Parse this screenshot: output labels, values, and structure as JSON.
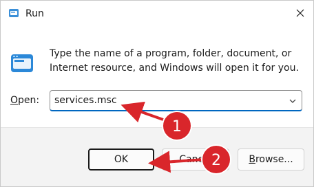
{
  "window": {
    "title": "Run",
    "close_icon": "close-icon",
    "app_icon": "run-icon"
  },
  "dialog": {
    "description_line1": "Type the name of a program, folder, document, or",
    "description_line2": "Internet resource, and Windows will open it for you.",
    "open_label_pre": "",
    "open_label_accel": "O",
    "open_label_post": "pen:",
    "open_value": "services.msc",
    "dropdown_icon": "chevron-down-icon"
  },
  "buttons": {
    "ok": "OK",
    "cancel": "Cancel",
    "browse_accel": "B",
    "browse_post": "rowse..."
  },
  "annotations": [
    {
      "number": "1",
      "points_to": "open-input"
    },
    {
      "number": "2",
      "points_to": "ok-button"
    }
  ],
  "colors": {
    "accent": "#0067c0",
    "annotation": "#d9262b",
    "footer_bg": "#f3f3f3"
  }
}
